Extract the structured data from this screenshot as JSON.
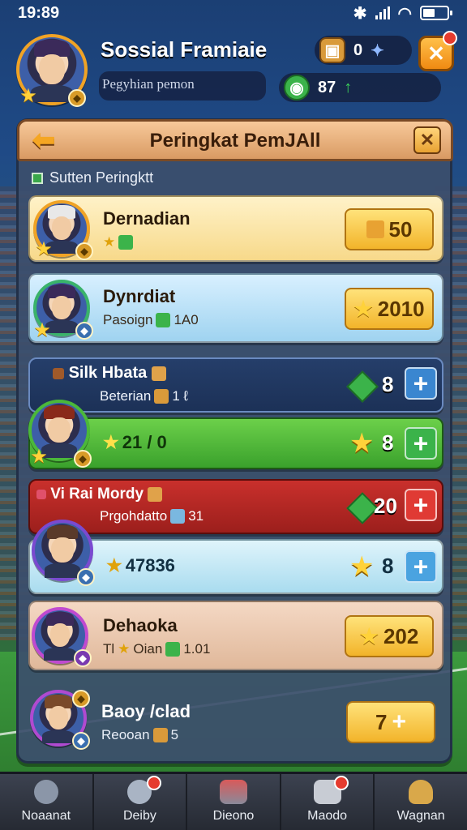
{
  "status_bar": {
    "time": "19:89"
  },
  "profile": {
    "name": "Sossial Framiaie",
    "subtitle": "Pegyhian pemon",
    "coins": "0",
    "gems": "87"
  },
  "panel": {
    "title": "Peringkat PemJAll",
    "section_label": "Sutten Peringktt"
  },
  "rows": [
    {
      "name": "Dernadian",
      "score": "50"
    },
    {
      "name": "Dynrdiat",
      "sub": "Pasoign",
      "sub_value": "1A0",
      "score": "2010"
    },
    {
      "name": "Silk Hbata",
      "sub": "Beterian",
      "sub_value": "1 ℓ",
      "count": "8"
    },
    {
      "stat": "21 / 0",
      "count": "8"
    },
    {
      "name": "Vi Rai Mordy",
      "sub": "Prgohdatto",
      "sub_value": "31",
      "count": "20"
    },
    {
      "stat": "47836",
      "count": "8"
    },
    {
      "name": "Dehaoka",
      "sub": "Tl",
      "sub_value": "Oian",
      "sub_value2": "1.01",
      "score": "202"
    },
    {
      "name": "Baoy /clad",
      "sub": "Reooan",
      "sub_value": "5",
      "score": "7"
    }
  ],
  "nav": [
    {
      "label": "Noaanat"
    },
    {
      "label": "Deiby"
    },
    {
      "label": "Dieono"
    },
    {
      "label": "Maodo"
    },
    {
      "label": "Wagnan"
    }
  ],
  "colors": {
    "accent_orange": "#f5a623",
    "gold": "#f2b42a",
    "green": "#3bb34a",
    "red": "#c9302c",
    "blue": "#4aa3e0"
  }
}
